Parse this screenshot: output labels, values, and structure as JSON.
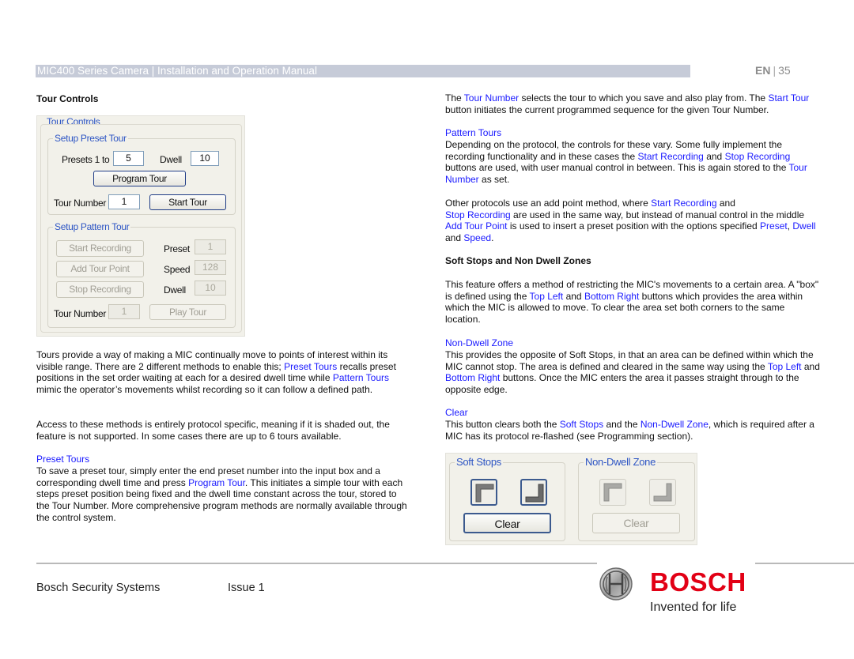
{
  "header": {
    "title": "MIC400 Series Camera | Installation and Operation Manual",
    "lang": "EN",
    "separator": "|",
    "page_number": "35"
  },
  "left": {
    "heading": "Tour Controls",
    "dialog": {
      "group_title": "Tour Controls",
      "preset_tour": {
        "legend": "Setup Preset Tour",
        "presets_label": "Presets 1 to",
        "presets_value": "5",
        "dwell_label": "Dwell",
        "dwell_value": "10",
        "program_button": "Program Tour",
        "tour_number_label": "Tour Number",
        "tour_number_value": "1",
        "start_button": "Start Tour"
      },
      "pattern_tour": {
        "legend": "Setup Pattern Tour",
        "start_recording": "Start Recording",
        "add_tour_point": "Add Tour Point",
        "stop_recording": "Stop Recording",
        "preset_label": "Preset",
        "preset_value": "1",
        "speed_label": "Speed",
        "speed_value": "128",
        "dwell_label": "Dwell",
        "dwell_value": "10",
        "tour_number_label": "Tour Number",
        "tour_number_value": "1",
        "play_button": "Play Tour"
      }
    },
    "p1": {
      "a": "Tours provide a way of making a MIC continually move to points of interest within its visible range. There are 2 different methods to enable this; ",
      "link1": "Preset Tours",
      "b": " recalls preset positions in the set order waiting at each for a desired dwell time while ",
      "link2": "Pattern Tours",
      "c": " mimic the operator’s movements whilst recording so it can follow a defined path."
    },
    "p2": "Access to these methods is entirely protocol specific, meaning if it is shaded out, the feature is not supported. In some cases there are up to 6 tours available.",
    "preset_tours": {
      "title": "Preset Tours",
      "a": "To save a preset tour, simply enter the end preset number into the input box and a corresponding dwell time and press ",
      "link": "Program Tour",
      "b": ". This initiates a simple tour with each steps preset position being fixed and the dwell time constant across the tour, stored to the Tour Number. More comprehensive program methods are normally available through the control system."
    }
  },
  "right": {
    "p1": {
      "a": "The ",
      "link1": "Tour Number",
      "b": " selects the tour to which you save and also play from. The ",
      "link2": "Start Tour",
      "c": " button initiates the current programmed sequence for the given Tour Number."
    },
    "pattern": {
      "title": "Pattern Tours",
      "a": "Depending on the protocol, the controls for these vary. Some fully implement the recording functionality and in these cases the ",
      "link1": "Start Recording",
      "b": " and ",
      "link2": "Stop Recording",
      "c": " buttons are used, with user manual control in between. This is again stored to the ",
      "link3": "Tour Number",
      "d": " as set."
    },
    "other": {
      "a": "Other protocols use an add point method, where ",
      "link1": "Start Recording",
      "b": " and ",
      "link2": "Stop Recording",
      "c": " are used in the same way, but instead of manual control in the middle ",
      "link3": "Add Tour Point",
      "d": " is used to insert a preset position with the options specified ",
      "link4": "Preset",
      "e": ", ",
      "link5": "Dwell",
      "f": " and ",
      "link6": "Speed",
      "g": "."
    },
    "soft_heading": "Soft Stops and Non Dwell Zones",
    "soft": {
      "a": "This feature offers a method of restricting the MIC's movements to a certain area. A \"box\" is defined using the ",
      "link1": "Top Left",
      "b": " and ",
      "link2": "Bottom Right",
      "c": " buttons which provides the area within which the MIC is allowed to move. To clear the area set both corners to the same location."
    },
    "nondwell": {
      "title": "Non-Dwell Zone",
      "a": "This provides the opposite of Soft Stops, in that an area can be defined within which the MIC cannot stop. The area is defined and cleared in the same way using the ",
      "link1": "Top Left",
      "b": " and ",
      "link2": "Bottom Right",
      "c": " buttons. Once the MIC enters the area it passes straight through to the opposite edge."
    },
    "clear": {
      "title": "Clear",
      "a": "This button clears both the ",
      "link1": "Soft Stops",
      "b": " and the ",
      "link2": "Non-Dwell Zone",
      "c": ", which is required after a MIC has its protocol re-flashed (see Programming section)."
    },
    "dialog": {
      "soft_legend": "Soft Stops",
      "soft_clear": "Clear",
      "nondwell_legend": "Non-Dwell Zone",
      "nondwell_clear": "Clear"
    }
  },
  "footer": {
    "company": "Bosch Security Systems",
    "issue": "Issue 1",
    "brand": "BOSCH",
    "tagline": "Invented for life"
  },
  "colors": {
    "link": "#1a1aff",
    "brand_red": "#e20015",
    "header_bar": "#c6cbd8"
  }
}
